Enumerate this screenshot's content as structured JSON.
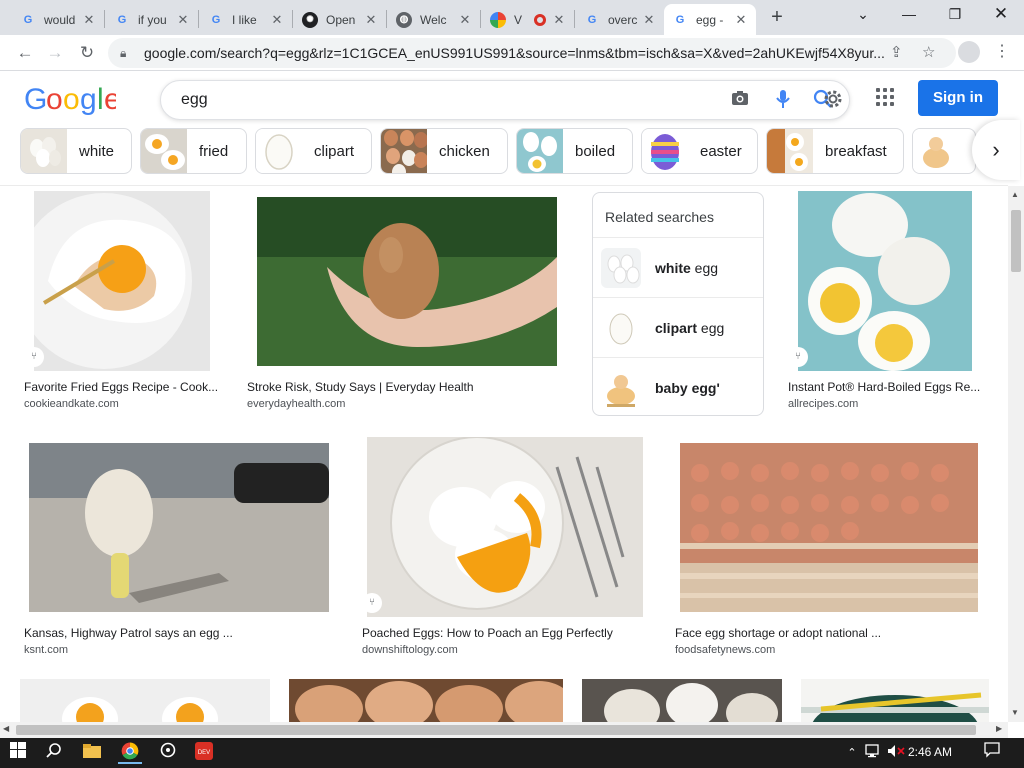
{
  "browser": {
    "tabs": [
      {
        "title": "would",
        "icon": "google-icon"
      },
      {
        "title": "if you",
        "icon": "google-icon"
      },
      {
        "title": "I like",
        "icon": "google-icon"
      },
      {
        "title": "Open",
        "icon": "openai-icon"
      },
      {
        "title": "Welc",
        "icon": "globe-icon"
      },
      {
        "title": "V",
        "icon": "colorful-app-icon"
      },
      {
        "title": "overc",
        "icon": "google-icon"
      },
      {
        "title": "egg -",
        "icon": "google-icon"
      }
    ],
    "url": "google.com/search?q=egg&rlz=1C1GCEA_enUS991US991&source=lnms&tbm=isch&sa=X&ved=2ahUKEwjf54X8yur..."
  },
  "google": {
    "logo": "Google",
    "query": "egg",
    "signin_label": "Sign in"
  },
  "chips": [
    {
      "label": "white"
    },
    {
      "label": "fried"
    },
    {
      "label": "clipart"
    },
    {
      "label": "chicken"
    },
    {
      "label": "boiled"
    },
    {
      "label": "easter"
    },
    {
      "label": "breakfast"
    }
  ],
  "results_row1": [
    {
      "title": "Favorite Fried Eggs Recipe - Cook...",
      "source": "cookieandkate.com",
      "badge": "⑂"
    },
    {
      "title": "Stroke Risk, Study Says | Everyday Health",
      "source": "everydayhealth.com"
    },
    {
      "title": "Instant Pot® Hard-Boiled Eggs Re...",
      "source": "allrecipes.com",
      "badge": "⑂"
    }
  ],
  "related": {
    "heading": "Related searches",
    "items": [
      {
        "bold": "white",
        "rest": " egg"
      },
      {
        "bold": "clipart",
        "rest": " egg"
      },
      {
        "bold": "baby egg'",
        "rest": ""
      }
    ]
  },
  "results_row2": [
    {
      "title": "Kansas, Highway Patrol says an egg ...",
      "source": "ksnt.com"
    },
    {
      "title": "Poached Eggs: How to Poach an Egg Perfectly",
      "source": "downshiftology.com",
      "badge": "⑂"
    },
    {
      "title": "Face egg shortage or adopt national ...",
      "source": "foodsafetynews.com"
    }
  ],
  "taskbar": {
    "time": "2:46 AM"
  },
  "colors": {
    "accent": "#1a73e8",
    "logo_blue": "#4285f4",
    "logo_red": "#ea4335",
    "logo_yellow": "#fbbc05",
    "logo_green": "#34a853"
  }
}
